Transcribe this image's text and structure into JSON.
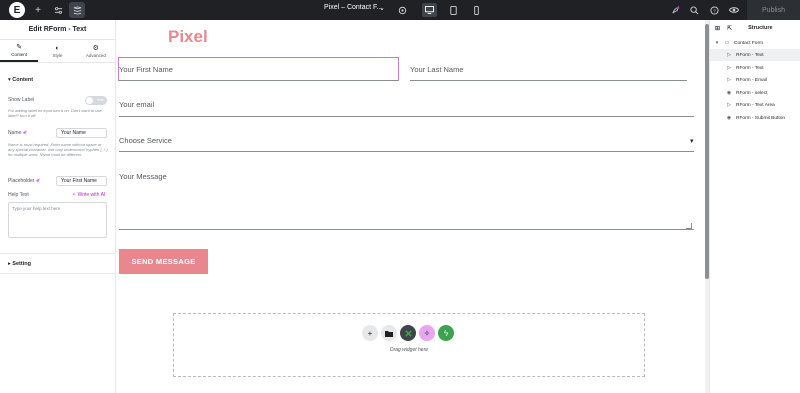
{
  "topbar": {
    "logo": "E",
    "page_title": "Pixel – Contact F...",
    "publish_label": "Publish"
  },
  "left_panel": {
    "title": "Edit RForm - Text",
    "tabs": [
      {
        "label": "Content",
        "icon": "pencil-icon"
      },
      {
        "label": "Style",
        "icon": "half-circle-icon"
      },
      {
        "label": "Advanced",
        "icon": "gear-icon"
      }
    ],
    "content_section": "Content",
    "show_label": {
      "label": "Show Label",
      "toggle_text": "Hide",
      "help": "For adding label on input turn it on. Don't want to use label? turn it off."
    },
    "name": {
      "label": "Name",
      "value": "Your Name",
      "help": "Name is must required. Enter name without space or any special character. use only underscore/ hyphen (_/-) for multiple word. Name must be different."
    },
    "placeholder": {
      "label": "Placeholder",
      "value": "Your First Name"
    },
    "help_text": {
      "label": "Help Text",
      "ai_label": "Write with AI",
      "placeholder": "Type your help text here"
    },
    "setting_section": "Setting"
  },
  "canvas": {
    "brand": "Pixel",
    "fields": {
      "first_name": "Your First Name",
      "last_name": "Your Last Name",
      "email": "Your email",
      "service": "Choose Service",
      "message": "Your Message"
    },
    "submit_label": "SEND MESSAGE",
    "dropzone_text": "Drag widget here"
  },
  "right_panel": {
    "title": "Structure",
    "root": "Contact Form",
    "items": [
      "RForm - Text",
      "RForm - Text",
      "RForm - Email",
      "RForm - select",
      "RForm - Text Area",
      "RForm - Submit Button"
    ]
  },
  "colors": {
    "accent_pink": "#e8888e",
    "selection_outline": "#c87bd6",
    "topbar_bg": "#1f2124",
    "dropzone_green": "#3aa34b",
    "dropzone_pink": "#e8a6ee"
  }
}
